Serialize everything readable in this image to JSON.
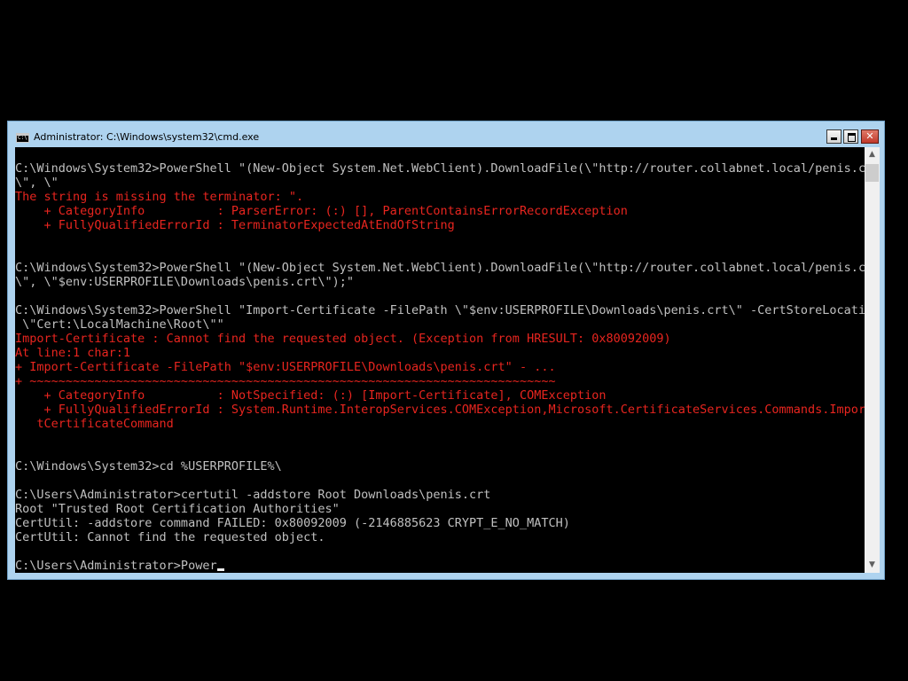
{
  "window": {
    "title": "Administrator: C:\\Windows\\system32\\cmd.exe",
    "icon": "cmd-icon"
  },
  "caption_buttons": {
    "minimize": "minimize-icon",
    "maximize": "maximize-icon",
    "close": "close-icon"
  },
  "colors": {
    "console_background": "#000000",
    "console_text": "#c0c0c0",
    "error_text": "#e8251f",
    "window_frame": "#aed3ef"
  },
  "console": {
    "lines": [
      {
        "text": "C:\\Windows\\System32>PowerShell \"(New-Object System.Net.WebClient).DownloadFile(\\\"http://router.collabnet.local/penis.crt",
        "style": "normal"
      },
      {
        "text": "\\\", \\\"",
        "style": "normal"
      },
      {
        "text": "The string is missing the terminator: \".",
        "style": "error"
      },
      {
        "text": "    + CategoryInfo          : ParserError: (:) [], ParentContainsErrorRecordException",
        "style": "error"
      },
      {
        "text": "    + FullyQualifiedErrorId : TerminatorExpectedAtEndOfString",
        "style": "error"
      },
      {
        "text": "",
        "style": "normal"
      },
      {
        "text": "",
        "style": "normal"
      },
      {
        "text": "C:\\Windows\\System32>PowerShell \"(New-Object System.Net.WebClient).DownloadFile(\\\"http://router.collabnet.local/penis.crt",
        "style": "normal"
      },
      {
        "text": "\\\", \\\"$env:USERPROFILE\\Downloads\\penis.crt\\\");\"",
        "style": "normal"
      },
      {
        "text": "",
        "style": "normal"
      },
      {
        "text": "C:\\Windows\\System32>PowerShell \"Import-Certificate -FilePath \\\"$env:USERPROFILE\\Downloads\\penis.crt\\\" -CertStoreLocation",
        "style": "normal"
      },
      {
        "text": " \\\"Cert:\\LocalMachine\\Root\\\"\"",
        "style": "normal"
      },
      {
        "text": "Import-Certificate : Cannot find the requested object. (Exception from HRESULT: 0x80092009)",
        "style": "error"
      },
      {
        "text": "At line:1 char:1",
        "style": "error"
      },
      {
        "text": "+ Import-Certificate -FilePath \"$env:USERPROFILE\\Downloads\\penis.crt\" - ...",
        "style": "error"
      },
      {
        "text": "+ ~~~~~~~~~~~~~~~~~~~~~~~~~~~~~~~~~~~~~~~~~~~~~~~~~~~~~~~~~~~~~~~~~~~~~~~~~",
        "style": "error"
      },
      {
        "text": "    + CategoryInfo          : NotSpecified: (:) [Import-Certificate], COMException",
        "style": "error"
      },
      {
        "text": "    + FullyQualifiedErrorId : System.Runtime.InteropServices.COMException,Microsoft.CertificateServices.Commands.Impor",
        "style": "error"
      },
      {
        "text": "   tCertificateCommand",
        "style": "error"
      },
      {
        "text": "",
        "style": "normal"
      },
      {
        "text": "",
        "style": "normal"
      },
      {
        "text": "C:\\Windows\\System32>cd %USERPROFILE%\\",
        "style": "normal"
      },
      {
        "text": "",
        "style": "normal"
      },
      {
        "text": "C:\\Users\\Administrator>certutil -addstore Root Downloads\\penis.crt",
        "style": "normal"
      },
      {
        "text": "Root \"Trusted Root Certification Authorities\"",
        "style": "normal"
      },
      {
        "text": "CertUtil: -addstore command FAILED: 0x80092009 (-2146885623 CRYPT_E_NO_MATCH)",
        "style": "normal"
      },
      {
        "text": "CertUtil: Cannot find the requested object.",
        "style": "normal"
      },
      {
        "text": "",
        "style": "normal"
      }
    ],
    "prompt": "C:\\Users\\Administrator>Power"
  },
  "scrollbar": {
    "up_icon": "scroll-up-arrow-icon",
    "down_icon": "scroll-down-arrow-icon"
  }
}
